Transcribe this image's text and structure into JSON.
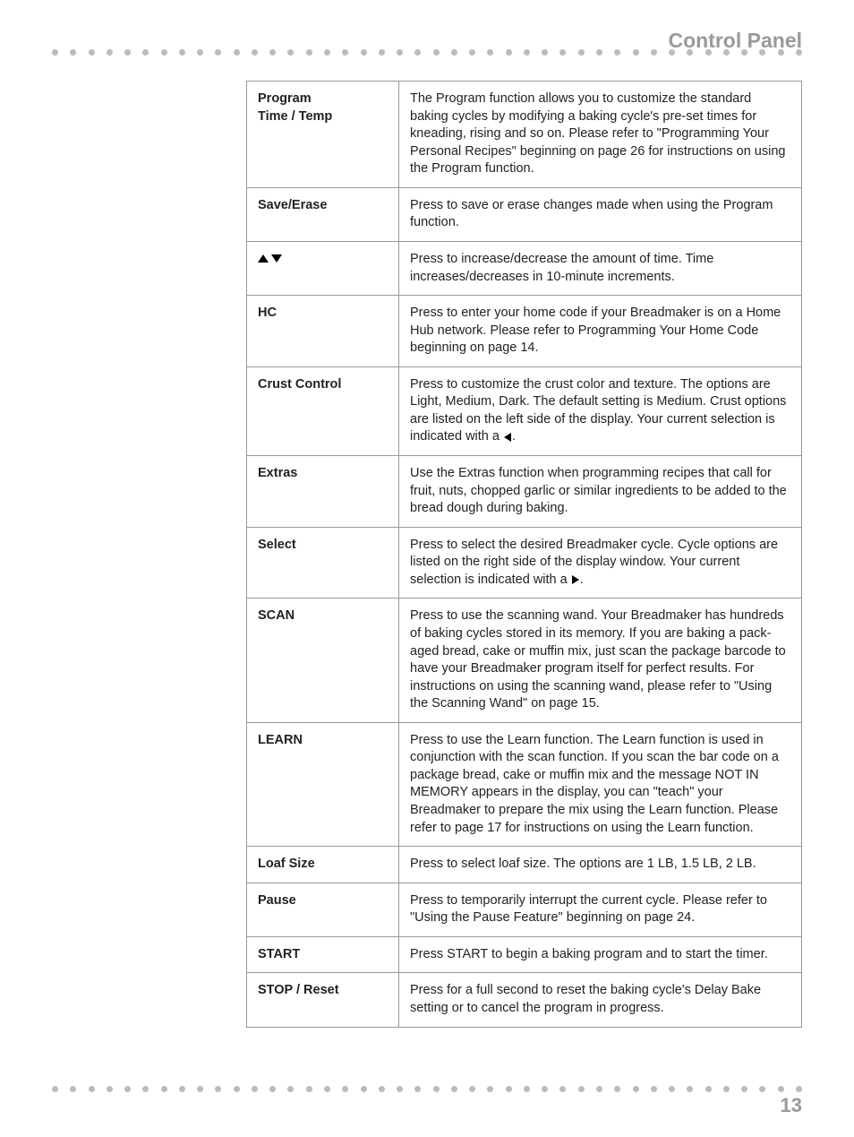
{
  "header": {
    "title": "Control Panel"
  },
  "page_number": "13",
  "rows": [
    {
      "label": "Program\nTime / Temp",
      "desc": "The Program function allows you to customize the standard baking cycles by modifying a baking cycle's pre-set times for kneading, rising and so on. Please refer to \"Programming Your Personal Recipes\" beginning on page 26 for instructions on using the Program function."
    },
    {
      "label": "Save/Erase",
      "desc": "Press to save or erase changes made when using the Program function."
    },
    {
      "label_icons": "up-down",
      "desc": "Press to increase/decrease the amount of time. Time increases/decreases in 10-minute increments."
    },
    {
      "label": "HC",
      "desc": "Press to enter your home code if your Breadmaker is on a Home Hub network. Please refer to Programming Your Home Code beginning on page 14."
    },
    {
      "label": "Crust Control",
      "desc_parts": {
        "pre": "Press to customize the crust color and texture. The options are Light, Medium, Dark. The default setting is Medium. Crust options are listed on the left side of the display. Your current selection is indicated with a ",
        "icon": "left",
        "post": "."
      }
    },
    {
      "label": "Extras",
      "desc": "Use the Extras function when programming recipes that call for fruit, nuts, chopped garlic or similar ingredients to be added to the bread dough during baking."
    },
    {
      "label": "Select",
      "desc_parts": {
        "pre": "Press to select the desired Breadmaker cycle. Cycle options are listed on the right side of the display window. Your current selection is indicated with a ",
        "icon": "right",
        "post": "."
      }
    },
    {
      "label": "SCAN",
      "desc": "Press to use the scanning wand. Your Breadmaker has hundreds of baking cycles stored in its memory. If you are baking a pack-aged bread, cake or muffin mix, just scan the package barcode to have your Breadmaker program itself for perfect results. For instructions on using the scanning wand, please refer to \"Using the Scanning Wand\" on page 15."
    },
    {
      "label": "LEARN",
      "desc": "Press to use the Learn function. The Learn function is used in conjunction with the scan function. If you scan the bar code on a package bread, cake or muffin mix and the message NOT IN MEMORY appears in the display, you can \"teach\" your Breadmaker to prepare the mix using the Learn function. Please refer to page 17 for instructions on using the Learn function."
    },
    {
      "label": "Loaf Size",
      "desc": "Press to select loaf size. The options are 1 LB, 1.5 LB, 2 LB."
    },
    {
      "label": "Pause",
      "desc": "Press to temporarily interrupt the current cycle. Please refer to \"Using the Pause Feature\" beginning on page 24."
    },
    {
      "label": "START",
      "desc": "Press START to begin a baking program and to start the timer."
    },
    {
      "label": "STOP / Reset",
      "desc": "Press for a full second to reset the baking cycle's Delay Bake setting or to cancel the program in progress."
    }
  ]
}
